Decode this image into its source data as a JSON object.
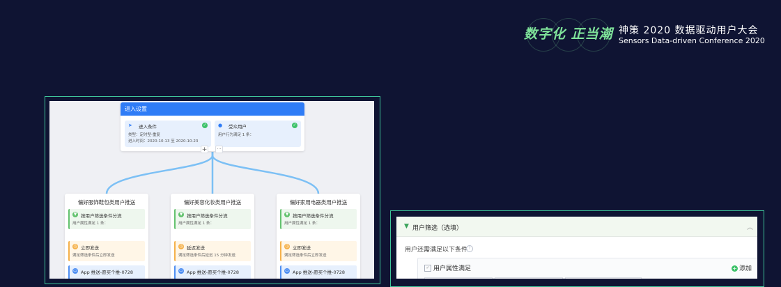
{
  "brand": {
    "logo_text": "数字化 正当潮",
    "title": "神策 2020 数据驱动用户大会",
    "subtitle": "Sensors Data-driven Conference 2020"
  },
  "entry": {
    "header": "进入设置",
    "condition": {
      "icon": "send-icon",
      "title": "进入条件",
      "line1": "类型：定时型-重复",
      "line2": "进入时间：2020-10-13 至 2020-10-23"
    },
    "audience": {
      "icon": "user-icon",
      "title": "受众用户",
      "line1": "用户行为满足 1 条："
    },
    "add_symbol": "+",
    "more_symbol": "···"
  },
  "branches": [
    {
      "title": "偏好服饰鞋包类用户推送",
      "filter": {
        "label": "按用户筛选条件分流",
        "desc": "用户属性满足 1 条："
      },
      "send": {
        "label": "立即发送",
        "desc": "满足筛选条件后立即发送"
      },
      "push": {
        "label": "App 推送-愿买个推-0728"
      }
    },
    {
      "title": "偏好美容化妆类用户推送",
      "filter": {
        "label": "按用户筛选条件分流",
        "desc": "用户属性满足 1 条："
      },
      "send": {
        "label": "延迟发送",
        "desc": "满足筛选条件后延迟 15 分钟发送"
      },
      "push": {
        "label": "App 推送-愿买个推-0728"
      }
    },
    {
      "title": "偏好家用电器类用户推送",
      "filter": {
        "label": "按用户筛选条件分流",
        "desc": "用户属性满足 1 条："
      },
      "send": {
        "label": "立即发送",
        "desc": "满足筛选条件后立即发送"
      },
      "push": {
        "label": "App 推送-愿买个推-0728"
      }
    }
  ],
  "filter_panel": {
    "title": "用户筛选（选填）",
    "condition_text": "用户还需满足以下条件",
    "group_title": "用户属性满足",
    "add_label": "添加"
  },
  "colors": {
    "background": "#0f1433",
    "accent_green": "#3fc59a",
    "primary_blue": "#2f7cf6",
    "connector": "#7cc0f5"
  }
}
